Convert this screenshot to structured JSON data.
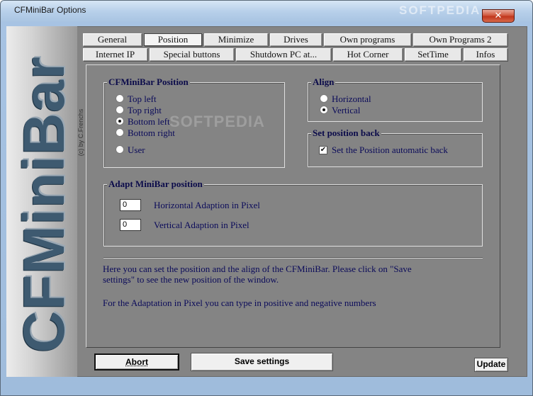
{
  "window": {
    "title": "CFMiniBar Options",
    "title_watermark": "SOFTPEDIA",
    "close_glyph": "✕"
  },
  "sidebar": {
    "logo_text": "CFMiniBar",
    "copyright": "(c) by C.Frenchs"
  },
  "tabs_row1": [
    "General",
    "Position",
    "Minimize",
    "Drives",
    "Own programs",
    "Own Programs 2"
  ],
  "tabs_row2": [
    "Internet IP",
    "Special buttons",
    "Shutdown PC at...",
    "Hot Corner",
    "SetTime",
    "Infos"
  ],
  "active_tab": "Position",
  "position_group": {
    "title": "CFMiniBar Position",
    "options": [
      {
        "label": "Top left",
        "checked": false
      },
      {
        "label": "Top right",
        "checked": false
      },
      {
        "label": "Bottom left",
        "checked": true
      },
      {
        "label": "Bottom right",
        "checked": false
      },
      {
        "label": "User",
        "checked": false
      }
    ]
  },
  "align_group": {
    "title": "Align",
    "options": [
      {
        "label": "Horizontal",
        "checked": false
      },
      {
        "label": "Vertical",
        "checked": true
      }
    ]
  },
  "set_back_group": {
    "title": "Set position back",
    "checkbox_label": "Set the Position automatic back",
    "checked": true,
    "check_glyph": "✔"
  },
  "adapt_group": {
    "title": "Adapt MiniBar position",
    "horizontal_value": "0",
    "horizontal_label": "Horizontal Adaption in Pixel",
    "vertical_value": "0",
    "vertical_label": "Vertical Adaption in Pixel"
  },
  "help": {
    "line1": "Here  you can set the position  and the align of  the  CFMiniBar. Please  click  on  \"Save",
    "line2": "settings\" to see  the new  position  of the window.",
    "line3": "For the Adaptation in Pixel you can type in positive and negative numbers"
  },
  "watermark_mid": "SOFTPEDIA",
  "buttons": {
    "abort": "Abort",
    "save": "Save settings",
    "update": "Update"
  }
}
